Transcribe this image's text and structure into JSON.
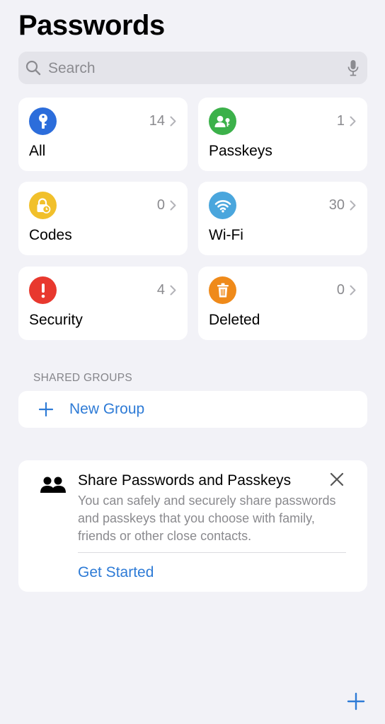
{
  "header": {
    "title": "Passwords"
  },
  "search": {
    "placeholder": "Search"
  },
  "categories": [
    {
      "label": "All",
      "count": "14",
      "icon": "key-icon",
      "color": "#2c6ddb"
    },
    {
      "label": "Passkeys",
      "count": "1",
      "icon": "person-key-icon",
      "color": "#3cb14a"
    },
    {
      "label": "Codes",
      "count": "0",
      "icon": "lock-clock-icon",
      "color": "#f1c02b"
    },
    {
      "label": "Wi-Fi",
      "count": "30",
      "icon": "wifi-icon",
      "color": "#4aa6dd"
    },
    {
      "label": "Security",
      "count": "4",
      "icon": "exclamation-icon",
      "color": "#e8382e"
    },
    {
      "label": "Deleted",
      "count": "0",
      "icon": "trash-icon",
      "color": "#ef8a1a"
    }
  ],
  "shared_groups": {
    "header": "SHARED GROUPS",
    "new_group_label": "New Group"
  },
  "share_card": {
    "title": "Share Passwords and Passkeys",
    "body": "You can safely and securely share passwords and passkeys that you choose with family, friends or other close contacts.",
    "action": "Get Started"
  },
  "colors": {
    "accent": "#2e7bd6",
    "background": "#f2f2f7",
    "card": "#ffffff"
  }
}
